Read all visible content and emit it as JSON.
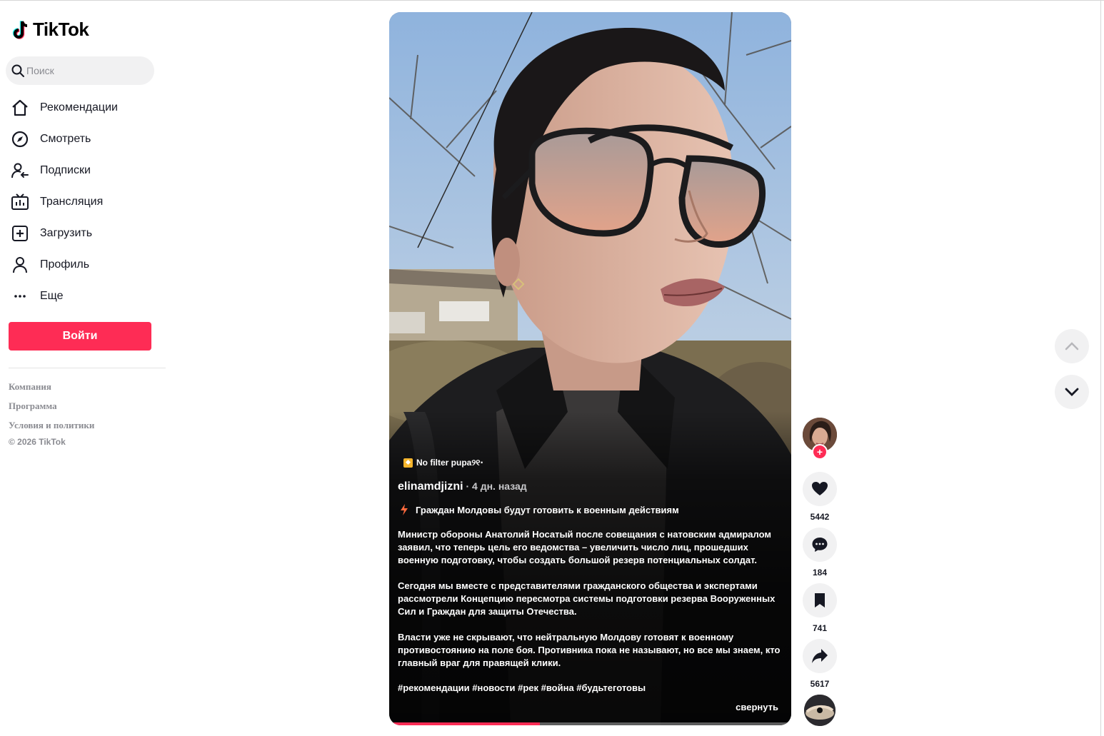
{
  "app": {
    "logo_text": "TikTok",
    "accent_color": "#fe2c55"
  },
  "search": {
    "placeholder": "Поиск",
    "value": ""
  },
  "sidebar": {
    "items": [
      {
        "label": "Рекомендации",
        "icon": "home-icon"
      },
      {
        "label": "Смотреть",
        "icon": "compass-icon"
      },
      {
        "label": "Подписки",
        "icon": "following-icon"
      },
      {
        "label": "Трансляция",
        "icon": "live-tv-icon"
      },
      {
        "label": "Загрузить",
        "icon": "upload-icon"
      },
      {
        "label": "Профиль",
        "icon": "profile-icon"
      },
      {
        "label": "Еще",
        "icon": "more-icon"
      }
    ],
    "login_label": "Войти",
    "footer_links": [
      "Компания",
      "Программа",
      "Условия и политики"
    ],
    "copyright": "© 2026 TikTok"
  },
  "video": {
    "music": "No filter pupa୨୧‧",
    "author": "elinamdjizni",
    "time": " · 4 дн. назад",
    "headline": "Граждан Молдовы будут готовить к военным действиям",
    "paragraphs": [
      "Министр обороны Анатолий Носатый после совещания с натовским адмиралом заявил, что теперь цель его ведомства – увеличить число лиц, прошедших военную подготовку, чтобы создать большой резерв потенциальных солдат.",
      "Сегодня мы вместе с представителями гражданского общества и экспертами рассмотрели Концепцию пересмотра системы подготовки резерва Вооруженных Сил и Граждан для защиты Отечества.",
      "Власти уже не скрывают, что нейтральную Молдову готовят к военному противостоянию на поле боя. Противника пока не называют, но все мы знаем, кто главный враг для правящей клики."
    ],
    "hashtags": "#рекомендации #новости #рек #война #будьтеготовы",
    "collapse_label": "свернуть",
    "progress": 0.375
  },
  "actions": {
    "likes": "5442",
    "comments": "184",
    "saves": "741",
    "shares": "5617",
    "follow_symbol": "+"
  }
}
